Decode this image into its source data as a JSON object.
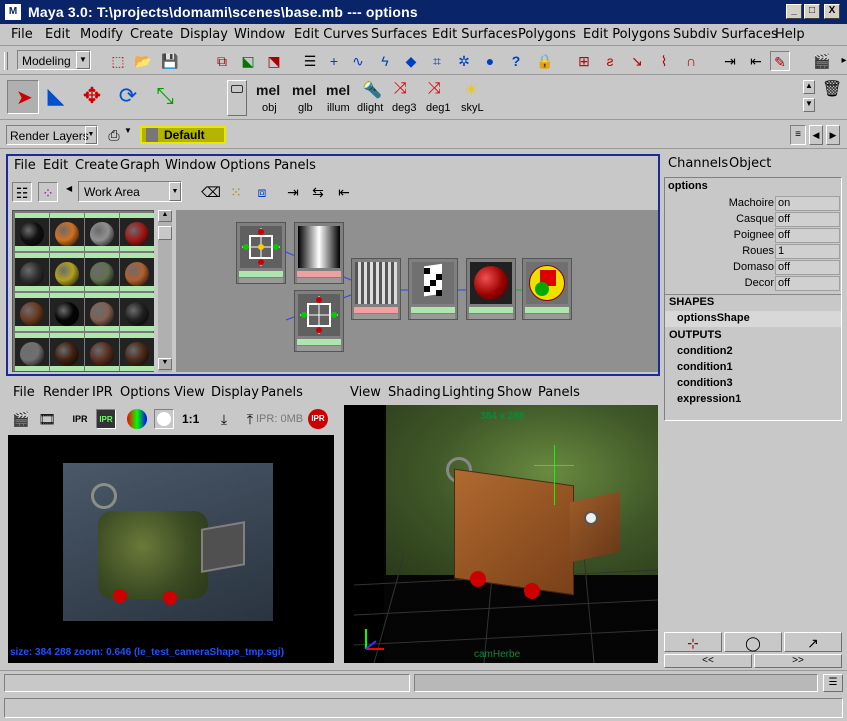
{
  "window": {
    "title": "Maya 3.0: T:\\projects\\domami\\scenes\\base.mb   ---   options",
    "logo": "M",
    "min": "_",
    "max": "□",
    "close": "X"
  },
  "menu": [
    "File",
    "Edit",
    "Modify",
    "Create",
    "Display",
    "Window",
    "Edit Curves",
    "Surfaces",
    "Edit Surfaces",
    "Polygons",
    "Edit Polygons",
    "Subdiv Surfaces",
    "Help"
  ],
  "toolbar": {
    "mode": "Modeling"
  },
  "shelf": {
    "items": [
      {
        "label": "obj",
        "top": "mel"
      },
      {
        "label": "glb",
        "top": "mel"
      },
      {
        "label": "illum",
        "top": "mel"
      },
      {
        "label": "dlight"
      },
      {
        "label": "deg3"
      },
      {
        "label": "deg1"
      },
      {
        "label": "skyL"
      }
    ]
  },
  "layers": {
    "dropdown": "Render Layers",
    "layer": "Default"
  },
  "hypershade": {
    "menu": [
      "File",
      "Edit",
      "Create",
      "Graph",
      "Window",
      "Options",
      "Panels"
    ],
    "workarea": "Work Area",
    "swatch_colors": [
      "#111111",
      "#d07020",
      "#909090",
      "#a01818",
      "#303030",
      "#b0a020",
      "#607050",
      "#b06030",
      "#6a3a20",
      "#050505",
      "#806050",
      "#202020",
      "#707070",
      "#402010",
      "#5a3020",
      "#4a2a18"
    ]
  },
  "render_view": {
    "menu": [
      "File",
      "Render",
      "IPR",
      "Options",
      "View",
      "Display",
      "Panels"
    ],
    "ratio": "1:1",
    "ipr_mem": "IPR: 0MB",
    "status": "size: 384 288 zoom: 0.646 (le_test_cameraShape_tmp.sgi)"
  },
  "viewport": {
    "menu": [
      "View",
      "Shading",
      "Lighting",
      "Show",
      "Panels"
    ],
    "resolution": "384 x 288",
    "camera": "camHerbe"
  },
  "channels": {
    "menu": [
      "Channels",
      "Object"
    ],
    "node": "options",
    "attrs": [
      {
        "name": "Machoire",
        "value": "on"
      },
      {
        "name": "Casque",
        "value": "off"
      },
      {
        "name": "Poignee",
        "value": "off"
      },
      {
        "name": "Roues",
        "value": "1"
      },
      {
        "name": "Domaso",
        "value": "off"
      },
      {
        "name": "Decor",
        "value": "off"
      }
    ],
    "shapes_header": "SHAPES",
    "shape": "optionsShape",
    "outputs_header": "OUTPUTS",
    "outputs": [
      "condition2",
      "condition1",
      "condition3",
      "expression1"
    ],
    "nav_left": "<<",
    "nav_right": ">>"
  }
}
